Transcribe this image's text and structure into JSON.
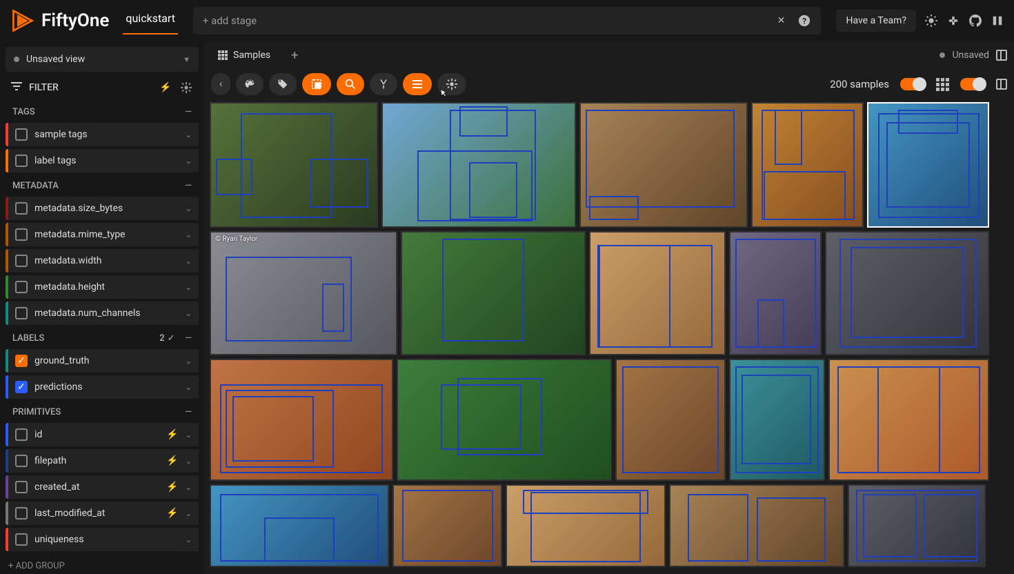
{
  "app": {
    "name": "FiftyOne",
    "dataset": "quickstart"
  },
  "stage_bar": {
    "add_stage": "+ add stage"
  },
  "hdr": {
    "team": "Have a Team?"
  },
  "view": {
    "text": "Unsaved view"
  },
  "filter": {
    "label": "FILTER"
  },
  "sections": {
    "tags": {
      "title": "TAGS",
      "items": [
        {
          "label": "sample tags",
          "color": "c-red"
        },
        {
          "label": "label tags",
          "color": "c-orange"
        }
      ]
    },
    "metadata": {
      "title": "METADATA",
      "items": [
        {
          "label": "metadata.size_bytes",
          "color": "c-darkred"
        },
        {
          "label": "metadata.mime_type",
          "color": "c-darkorange"
        },
        {
          "label": "metadata.width",
          "color": "c-darkorange"
        },
        {
          "label": "metadata.height",
          "color": "c-green"
        },
        {
          "label": "metadata.num_channels",
          "color": "c-teal"
        }
      ]
    },
    "labels": {
      "title": "LABELS",
      "count": "2",
      "items": [
        {
          "label": "ground_truth",
          "color": "c-teal",
          "checked": "orange"
        },
        {
          "label": "predictions",
          "color": "c-blue",
          "checked": "blue"
        }
      ]
    },
    "primitives": {
      "title": "PRIMITIVES",
      "items": [
        {
          "label": "id",
          "color": "c-blue",
          "bolt": true
        },
        {
          "label": "filepath",
          "color": "c-darkblue",
          "bolt": true
        },
        {
          "label": "created_at",
          "color": "c-purple",
          "bolt": true
        },
        {
          "label": "last_modified_at",
          "color": "c-grey",
          "bolt": true
        },
        {
          "label": "uniqueness",
          "color": "c-red"
        }
      ]
    }
  },
  "add_group": "+ ADD GROUP",
  "tab": "Samples",
  "unsaved": "Unsaved",
  "samples_count": "200 samples",
  "attrib": "© Ryan Taylor"
}
